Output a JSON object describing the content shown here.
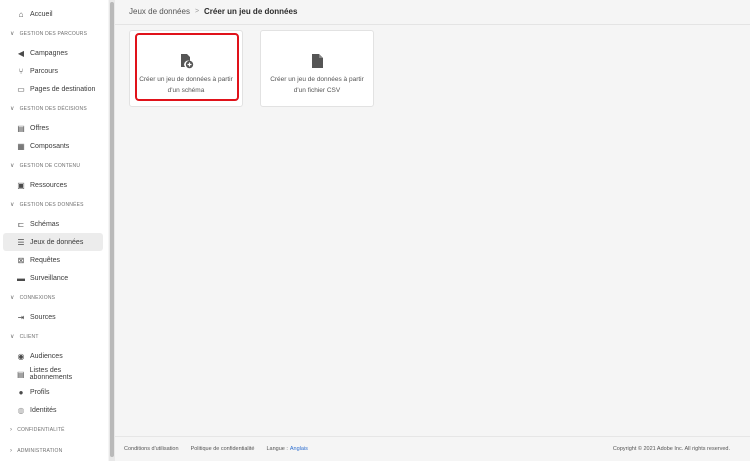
{
  "sidebar": {
    "home": "Accueil",
    "sections": [
      {
        "title": "GESTION DES PARCOURS",
        "items": [
          "Campagnes",
          "Parcours",
          "Pages de destination"
        ]
      },
      {
        "title": "GESTION DES DÉCISIONS",
        "items": [
          "Offres",
          "Composants"
        ]
      },
      {
        "title": "GESTION DE CONTENU",
        "items": [
          "Ressources"
        ]
      },
      {
        "title": "GESTION DES DONNÉES",
        "items": [
          "Schémas",
          "Jeux de données",
          "Requêtes",
          "Surveillance"
        ]
      },
      {
        "title": "CONNEXIONS",
        "items": [
          "Sources"
        ]
      },
      {
        "title": "CLIENT",
        "items": [
          "Audiences",
          "Listes des abonnements",
          "Profils",
          "Identités"
        ]
      },
      {
        "title": "CONFIDENTIALITÉ",
        "items": []
      },
      {
        "title": "ADMINISTRATION",
        "items": []
      }
    ],
    "selected": "Jeux de données"
  },
  "breadcrumb": {
    "parent": "Jeux de données",
    "separator": ">",
    "current": "Créer un jeu de données"
  },
  "cards": [
    {
      "label": "Créer un jeu de données à partir d'un schéma",
      "icon": "file-add-icon",
      "highlighted": true
    },
    {
      "label": "Créer un jeu de données à partir d'un fichier CSV",
      "icon": "file-icon",
      "highlighted": false
    }
  ],
  "footer": {
    "terms": "Conditions d'utilisation",
    "privacy": "Politique de confidentialité",
    "language_label": "Langue :",
    "language_value": "Anglais",
    "copyright": "Copyright © 2021 Adobe Inc. All rights reserved."
  },
  "colors": {
    "highlight": "#e0121a",
    "link": "#2d6ed0"
  }
}
